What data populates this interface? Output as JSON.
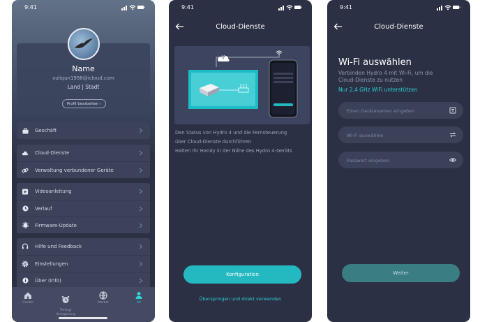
{
  "statusbar": {
    "time": "9:41"
  },
  "profile": {
    "name": "Name",
    "email": "xuliqun1998@icloud.com",
    "location": "Land  |  Stadt",
    "edit_button": "Profil bearbeiten"
  },
  "menu": {
    "group_a": [
      "Geschäft"
    ],
    "group_b": [
      "Cloud-Dienste",
      "Verwaltung verbundener Geräte"
    ],
    "group_c": [
      "Videoanleitung",
      "Verlauf",
      "Firmware-Update"
    ],
    "group_d": [
      "Hilfe und Feedback",
      "Einstellungen",
      "Über (Info)"
    ]
  },
  "bottom_nav": {
    "items": [
      "Geräte",
      "Timing/\nVerlagerung",
      "Market",
      "Ich"
    ],
    "active_color": "#2bd5da"
  },
  "cloud_screen": {
    "title": "Cloud-Dienste",
    "desc1": "Den Status von Hydro 4 und die Fernsteuerung",
    "desc2": "über Cloud-Dienste durchführen",
    "desc3": "Halten Ihr Handy in der Nähe des Hydro 4-Geräts",
    "config_button": "Konfiguration",
    "skip_link": "Überspringen und direkt verwenden"
  },
  "wifi_screen": {
    "title": "Cloud-Dienste",
    "heading": "Wi-Fi auswählen",
    "subtitle1": "Verbinden Hydro 4 mit Wi-Fi, um die",
    "subtitle2": "Cloud-Dienste zu nutzen",
    "hint": "Nur 2,4 GHz WiFi unterstützen",
    "device_name_placeholder": "Einen Gerätenamen eingeben",
    "wifi_placeholder": "Wi-Fi auswählen",
    "password_placeholder": "Passwort eingeben",
    "next_button": "Weiter"
  },
  "colors": {
    "background": "#2c3044",
    "accent": "#24b9c0",
    "card": "#3b4259"
  }
}
